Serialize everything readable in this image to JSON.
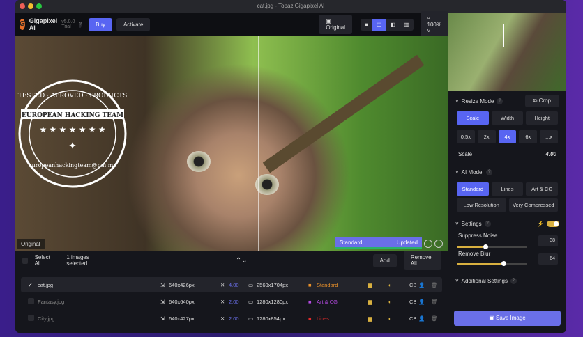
{
  "window": {
    "title": "cat.jpg - Topaz Gigapixel AI"
  },
  "toolbar": {
    "app_name": "Gigapixel AI",
    "version": "v5.0.0 Trial",
    "help": "?",
    "buy": "Buy",
    "activate": "Activate",
    "original": "Original",
    "zoom": "100%"
  },
  "viewer": {
    "original_label": "Original",
    "model": "Standard",
    "status": "Updated"
  },
  "stamp": {
    "top": "TESTED · APROVED · PRODUCTS",
    "middle": "EUROPEAN HACKING TEAM",
    "bottom": "europeanhackingteam@pm.me"
  },
  "files": {
    "select_all": "Select All",
    "selected_count": "1 images selected",
    "add": "Add",
    "remove_all": "Remove All",
    "rows": [
      {
        "name": "cat.jpg",
        "input": "640x426px",
        "scale": "4.00",
        "output": "2560x1704px",
        "model": "Standard",
        "model_color": "#e8902a",
        "cb": "CB",
        "checked": true
      },
      {
        "name": "Fantasy.jpg",
        "input": "640x640px",
        "scale": "2.00",
        "output": "1280x1280px",
        "model": "Art & CG",
        "model_color": "#b44ae0",
        "cb": "CB",
        "checked": false
      },
      {
        "name": "City.jpg",
        "input": "640x427px",
        "scale": "2.00",
        "output": "1280x854px",
        "model": "Lines",
        "model_color": "#e02a2a",
        "cb": "CB",
        "checked": false
      }
    ]
  },
  "side": {
    "resize_mode": "Resize Mode",
    "help": "?",
    "crop": "Crop",
    "modes": [
      "Scale",
      "Width",
      "Height"
    ],
    "scales": [
      "0.5x",
      "2x",
      "4x",
      "6x",
      "...x"
    ],
    "scale_label": "Scale",
    "scale_value": "4.00",
    "ai_model": "AI Model",
    "models": [
      "Standard",
      "Lines",
      "Art & CG",
      "Low Resolution",
      "Very Compressed"
    ],
    "settings": "Settings",
    "suppress_noise": "Suppress Noise",
    "suppress_noise_value": "38",
    "remove_blur": "Remove Blur",
    "remove_blur_value": "64",
    "additional": "Additional Settings",
    "save": "Save Image",
    "accent": "#5865f2"
  }
}
